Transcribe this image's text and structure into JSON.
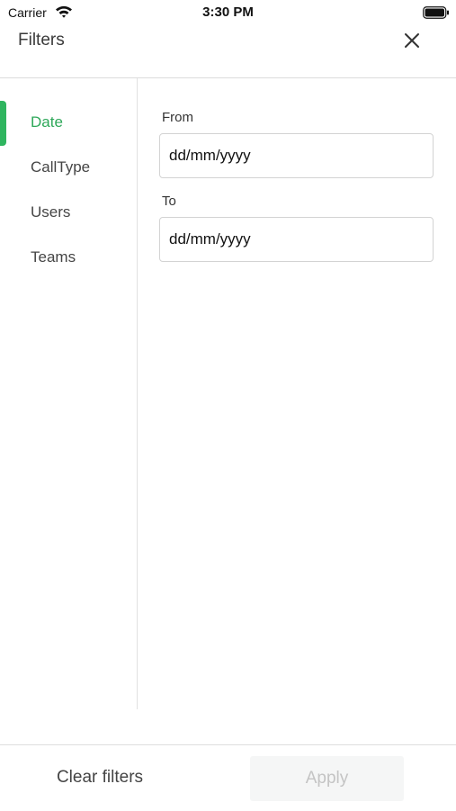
{
  "status_bar": {
    "carrier": "Carrier",
    "time": "3:30 PM",
    "icons": [
      "wifi-icon",
      "battery-icon"
    ]
  },
  "header": {
    "title": "Filters",
    "close_icon": "close-icon"
  },
  "sidebar": {
    "active_index": 0,
    "items": [
      {
        "label": "Date"
      },
      {
        "label": "CallType"
      },
      {
        "label": "Users"
      },
      {
        "label": "Teams"
      }
    ]
  },
  "main": {
    "from": {
      "label": "From",
      "placeholder": "dd/mm/yyyy",
      "value": ""
    },
    "to": {
      "label": "To",
      "placeholder": "dd/mm/yyyy",
      "value": ""
    }
  },
  "footer": {
    "clear_label": "Clear filters",
    "apply_label": "Apply",
    "apply_enabled": false
  },
  "colors": {
    "accent": "#2fb55f",
    "active_text": "#2fa85a",
    "disabled_button_bg": "#f5f6f6",
    "disabled_button_text": "#c4c4c4"
  }
}
